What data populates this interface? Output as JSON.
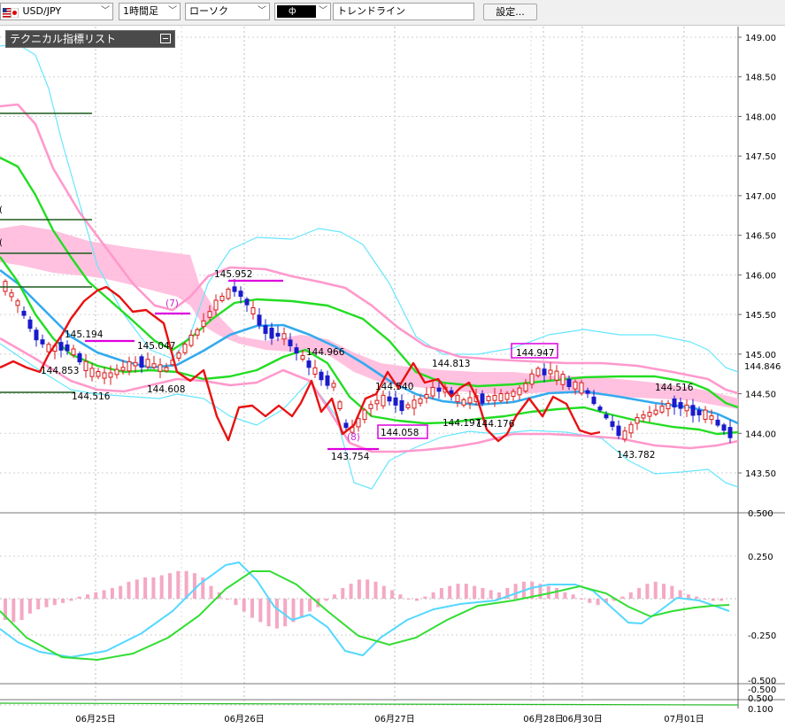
{
  "toolbar": {
    "symbol": "USD/JPY",
    "flag_icon": "us-jp-flag-icon",
    "timeframe": "1時間足",
    "chart_type": "ローソク",
    "color_swatch": "black-swatch-icon",
    "drawing_tool": "トレンドライン",
    "settings_label": "設定..."
  },
  "indicator_panel": {
    "title": "テクニカル指標リスト"
  },
  "price_axis": {
    "labels": [
      "149.00",
      "148.50",
      "148.00",
      "147.50",
      "147.00",
      "146.50",
      "146.00",
      "145.50",
      "145.00",
      "144.50",
      "144.00",
      "143.50"
    ],
    "current_price": "144.846"
  },
  "macd_axis": {
    "labels": [
      "0.500",
      "0.250",
      "-0.250",
      "-0.500",
      "-0.500"
    ]
  },
  "bottom_axis": {
    "labels": [
      "0.500",
      "0.100"
    ]
  },
  "date_labels": [
    "06月25日",
    "06月26日",
    "06月27日",
    "06月28日",
    "06月30日",
    "07月01日"
  ],
  "annotations": {
    "high_labels": [
      "145.952",
      "145.194",
      "145.047",
      "144.966",
      "144.813",
      "144.540",
      "144.947",
      "144.516"
    ],
    "low_labels": [
      "144.853",
      "144.516",
      "144.608",
      "143.754",
      "144.058",
      "144.197",
      "144.176",
      "143.782"
    ],
    "markers": [
      "(7)",
      "(8)"
    ]
  },
  "left_edge_markers": [
    "(",
    "("
  ],
  "colors": {
    "bull_candle": "#d61a1a",
    "bear_candle": "#1a1acc",
    "cloud": "#ffb6d9",
    "sma_green": "#22dd22",
    "sma_blue": "#33aaee",
    "bollinger_cyan": "#66e6ff",
    "bollinger_pink": "#ff99cc",
    "red_line": "#e81111",
    "magenta_marker": "#dd00dd",
    "dark_green_level": "#1a5a1a"
  }
}
